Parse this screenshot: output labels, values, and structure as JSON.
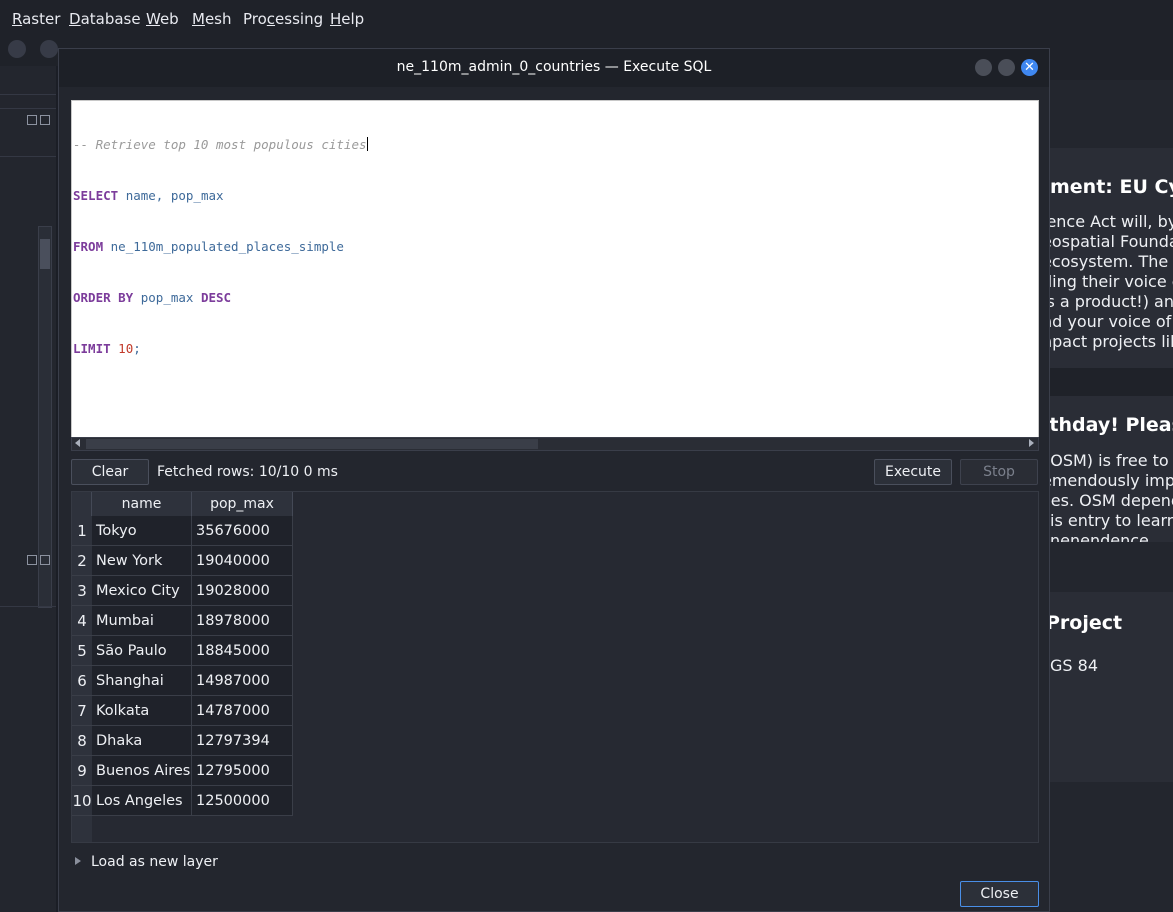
{
  "menu": {
    "items": [
      "Raster",
      "Database",
      "Web",
      "Mesh",
      "Processing",
      "Help"
    ],
    "underline": [
      "R",
      "D",
      "W",
      "M",
      "c",
      "H"
    ]
  },
  "news": {
    "item1_title": "ment: EU Cybe",
    "item1_lines": [
      "ience Act will, by",
      "eospatial Founda",
      "ecosystem. The C",
      "ding their voice c",
      "is a product!) anc",
      "nd your voice of",
      "npact projects lik"
    ],
    "item2_title": "rthday! Please",
    "item2_lines": [
      "(OSM) is free to",
      "emendously impr",
      "ces. OSM depend",
      "is entry to learn l",
      "nenendence"
    ],
    "project_title": "Project",
    "project_crs": "GS 84"
  },
  "dialog": {
    "title": "ne_110m_admin_0_countries — Execute SQL",
    "sql": {
      "comment": "-- Retrieve top 10 most populous cities",
      "kw_select": "SELECT",
      "select_cols": "name, pop_max",
      "kw_from": "FROM",
      "table": "ne_110m_populated_places_simple",
      "kw_order": "ORDER BY",
      "order_col": "pop_max",
      "kw_desc": "DESC",
      "kw_limit": "LIMIT",
      "limit_val": "10",
      "semicolon": ";"
    },
    "clear_label": "Clear",
    "status": "Fetched rows: 10/10  0 ms",
    "execute_label": "Execute",
    "stop_label": "Stop",
    "columns": [
      "name",
      "pop_max"
    ],
    "rows": [
      {
        "n": "1",
        "name": "Tokyo",
        "pop_max": "35676000"
      },
      {
        "n": "2",
        "name": "New York",
        "pop_max": "19040000"
      },
      {
        "n": "3",
        "name": "Mexico City",
        "pop_max": "19028000"
      },
      {
        "n": "4",
        "name": "Mumbai",
        "pop_max": "18978000"
      },
      {
        "n": "5",
        "name": "São Paulo",
        "pop_max": "18845000"
      },
      {
        "n": "6",
        "name": "Shanghai",
        "pop_max": "14987000"
      },
      {
        "n": "7",
        "name": "Kolkata",
        "pop_max": "14787000"
      },
      {
        "n": "8",
        "name": "Dhaka",
        "pop_max": "12797394"
      },
      {
        "n": "9",
        "name": "Buenos Aires",
        "pop_max": "12795000"
      },
      {
        "n": "10",
        "name": "Los Angeles",
        "pop_max": "12500000"
      }
    ],
    "load_layer_label": "Load as new layer",
    "close_label": "Close"
  },
  "colors": {
    "accent": "#3f87f0",
    "keyword": "#7c3c9b",
    "identifier": "#3e6a9a",
    "number": "#c23a2a"
  }
}
